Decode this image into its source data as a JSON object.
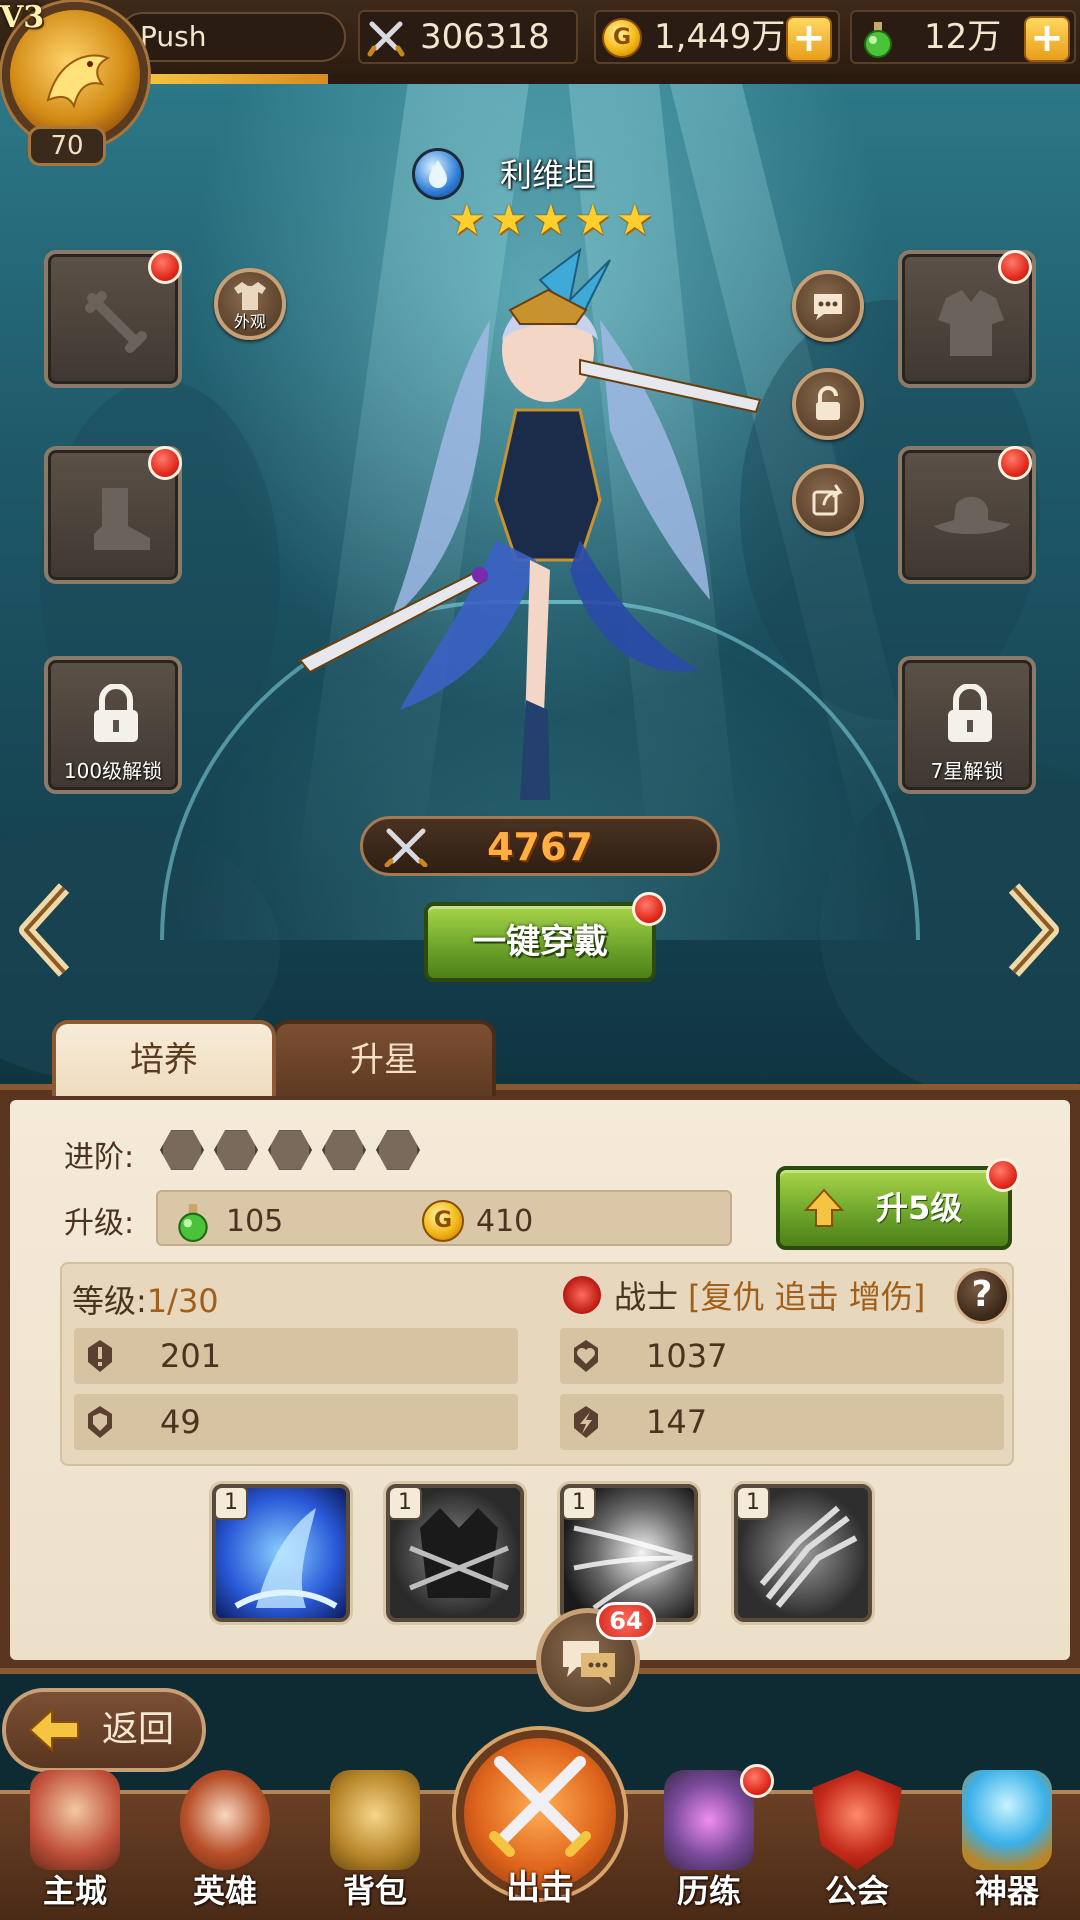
{
  "player": {
    "vip": "V3",
    "level": "70",
    "name": "Push",
    "xp_fraction": 0.2
  },
  "resources": {
    "power": "306318",
    "gold": "1,449万",
    "potion": "12万"
  },
  "hero": {
    "name": "利维坦",
    "stars": 5,
    "element": "water-drop-icon",
    "combat_power": "4767"
  },
  "equipment": {
    "skin_label": "外观",
    "lock_left_label": "100级解锁",
    "lock_right_label": "7星解锁",
    "equip_all_label": "一键穿戴"
  },
  "tabs": {
    "train": "培养",
    "star_up": "升星"
  },
  "panel": {
    "advance_label": "进阶:",
    "upgrade_label": "升级:",
    "cost_potion": "105",
    "cost_gold": "410",
    "upgrade_button": "升5级",
    "level_label": "等级:",
    "level_value": "1/30",
    "class_name": "战士",
    "class_traits": "[复仇 追击 增伤]",
    "help": "?",
    "stats": {
      "attack": "201",
      "hp": "1037",
      "defense": "49",
      "speed": "147"
    },
    "skills": [
      {
        "level": "1"
      },
      {
        "level": "1"
      },
      {
        "level": "1"
      },
      {
        "level": "1"
      }
    ],
    "chat_count": "64"
  },
  "bottom": {
    "back": "返回",
    "nav": {
      "city": "主城",
      "heroes": "英雄",
      "bag": "背包",
      "battle": "出击",
      "trials": "历练",
      "guild": "公会",
      "artifact": "神器"
    }
  },
  "colors": {
    "accent_green": "#6aa22a",
    "badge_red": "#e22b1e",
    "gold": "#f3b815",
    "panel_bg": "#f4ead8",
    "frame_brown": "#8a5a32"
  }
}
